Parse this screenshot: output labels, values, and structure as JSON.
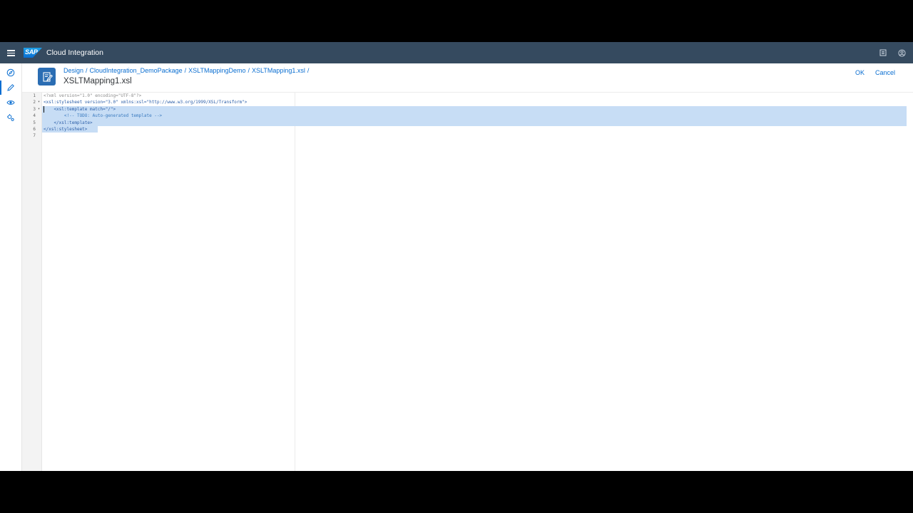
{
  "shell": {
    "logo_text": "SAP",
    "product_title": "Cloud Integration",
    "bg_color": "#354a5f"
  },
  "nav": {
    "items": [
      {
        "icon": "discover-icon"
      },
      {
        "icon": "design-pencil-icon",
        "active": true
      },
      {
        "icon": "monitor-eye-icon"
      },
      {
        "icon": "settings-icon"
      }
    ],
    "bottom_icon": "pin-icon"
  },
  "header": {
    "breadcrumb": [
      "Design",
      "CloudIntegration_DemoPackage",
      "XSLTMappingDemo",
      "XSLTMapping1.xsl"
    ],
    "breadcrumb_sep": "/",
    "title": "XSLTMapping1.xsl",
    "ok_label": "OK",
    "cancel_label": "Cancel"
  },
  "editor": {
    "lines": [
      {
        "num": "1",
        "fold": "",
        "text": "<?xml version=\"1.0\" encoding=\"UTF-8\"?>"
      },
      {
        "num": "2",
        "fold": "▾",
        "text": "<xsl:stylesheet version=\"3.0\" xmlns:xsl=\"http://www.w3.org/1999/XSL/Transform\">"
      },
      {
        "num": "3",
        "fold": "▾",
        "text": "    <xsl:template match=\"/\">"
      },
      {
        "num": "4",
        "fold": "",
        "text": "        <!-- TODO: Auto-generated template -->"
      },
      {
        "num": "5",
        "fold": "",
        "text": "    </xsl:template>"
      },
      {
        "num": "6",
        "fold": "",
        "text": "</xsl:stylesheet>"
      },
      {
        "num": "7",
        "fold": "",
        "text": ""
      }
    ],
    "selection_color": "#c7ddf5"
  }
}
